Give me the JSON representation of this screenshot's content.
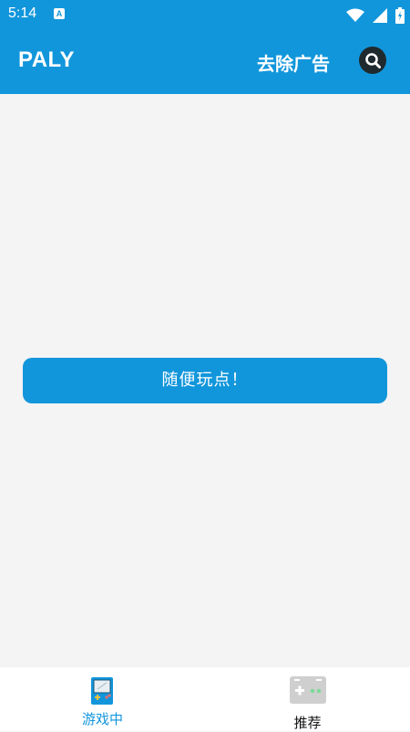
{
  "status_bar": {
    "time": "5:14",
    "notif_glyph": "A"
  },
  "app_bar": {
    "title": "PALY",
    "remove_ads_label": "去除广告",
    "search_icon": "search-icon"
  },
  "main": {
    "random_play_label": "随便玩点！"
  },
  "bottom_nav": {
    "items": [
      {
        "label": "游戏中",
        "icon": "gameboy-icon",
        "active": true
      },
      {
        "label": "推荐",
        "icon": "gamepad-icon",
        "active": false
      }
    ]
  },
  "colors": {
    "primary": "#1296db",
    "background": "#f4f4f4",
    "search_bg": "#1f2a2e"
  }
}
